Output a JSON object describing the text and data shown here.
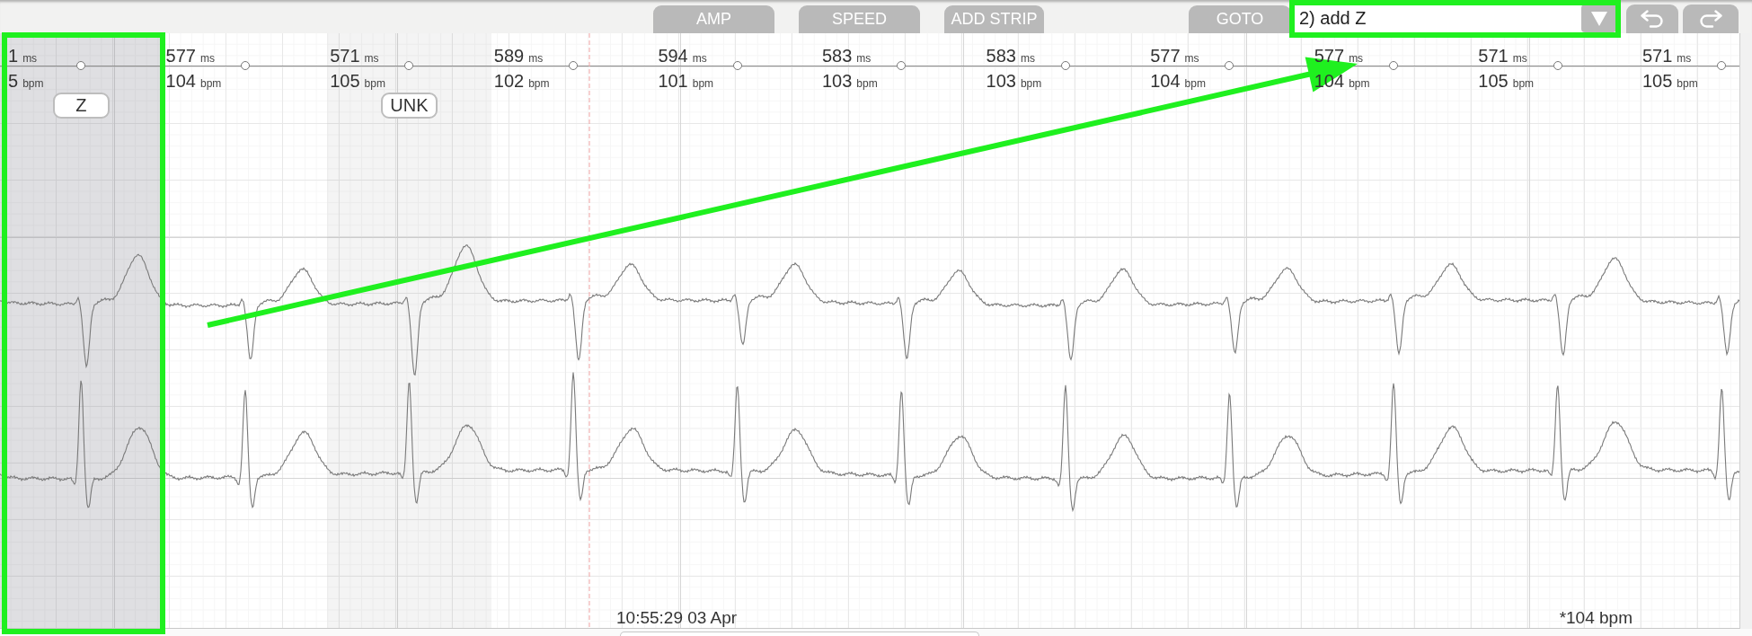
{
  "toolbar": {
    "buttons": [
      {
        "label": "AMP"
      },
      {
        "label": "SPEED"
      },
      {
        "label": "ADD STRIP"
      },
      {
        "label": "GOTO"
      }
    ],
    "history_select": {
      "value": "2) add Z"
    }
  },
  "rhythm_strip": {
    "beats": [
      {
        "interval": {
          "value": "1",
          "unit": "ms"
        },
        "rate": {
          "value": "5",
          "unit": "bpm"
        },
        "region": {
          "label": "Z",
          "selected": true
        }
      },
      {
        "interval": {
          "value": "577",
          "unit": "ms"
        },
        "rate": {
          "value": "104",
          "unit": "bpm"
        }
      },
      {
        "interval": {
          "value": "571",
          "unit": "ms"
        },
        "rate": {
          "value": "105",
          "unit": "bpm"
        },
        "region": {
          "label": "UNK",
          "selected": false
        }
      },
      {
        "interval": {
          "value": "589",
          "unit": "ms"
        },
        "rate": {
          "value": "102",
          "unit": "bpm"
        }
      },
      {
        "interval": {
          "value": "594",
          "unit": "ms"
        },
        "rate": {
          "value": "101",
          "unit": "bpm"
        }
      },
      {
        "interval": {
          "value": "583",
          "unit": "ms"
        },
        "rate": {
          "value": "103",
          "unit": "bpm"
        }
      },
      {
        "interval": {
          "value": "583",
          "unit": "ms"
        },
        "rate": {
          "value": "103",
          "unit": "bpm"
        }
      },
      {
        "interval": {
          "value": "577",
          "unit": "ms"
        },
        "rate": {
          "value": "104",
          "unit": "bpm"
        }
      },
      {
        "interval": {
          "value": "577",
          "unit": "ms"
        },
        "rate": {
          "value": "104",
          "unit": "bpm"
        }
      },
      {
        "interval": {
          "value": "571",
          "unit": "ms"
        },
        "rate": {
          "value": "105",
          "unit": "bpm"
        }
      },
      {
        "interval": {
          "value": "571",
          "unit": "ms"
        },
        "rate": {
          "value": "105",
          "unit": "bpm"
        }
      }
    ]
  },
  "footer": {
    "timestamp": "10:55:29 03 Apr",
    "average_rate": "*104 bpm"
  }
}
